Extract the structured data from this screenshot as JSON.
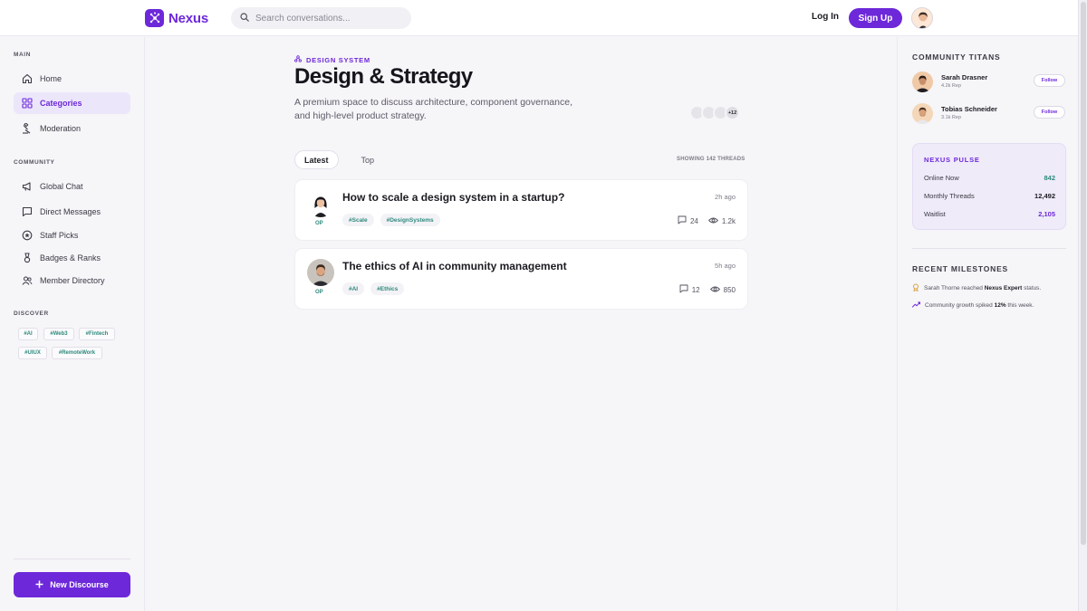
{
  "app": {
    "name": "Nexus",
    "accent": "#6d28d9",
    "teal": "#2e8a7d"
  },
  "header": {
    "search_placeholder": "Search conversations...",
    "login_label": "Log In",
    "signup_label": "Sign Up"
  },
  "sidebar": {
    "main_label": "MAIN",
    "main_items": [
      {
        "label": "Home",
        "icon": "home-icon",
        "active": false
      },
      {
        "label": "Categories",
        "icon": "grid-icon",
        "active": true
      },
      {
        "label": "Moderation",
        "icon": "gavel-icon",
        "active": false
      }
    ],
    "community_label": "COMMUNITY",
    "community_items": [
      {
        "label": "Global Chat",
        "icon": "megaphone-icon"
      },
      {
        "label": "Direct Messages",
        "icon": "message-icon"
      },
      {
        "label": "Staff Picks",
        "icon": "star-icon"
      },
      {
        "label": "Badges & Ranks",
        "icon": "medal-icon"
      },
      {
        "label": "Member Directory",
        "icon": "users-icon"
      }
    ],
    "discover_label": "DISCOVER",
    "discover_tags": [
      "#AI",
      "#Web3",
      "#Fintech",
      "#UIUX",
      "#RemoteWork"
    ],
    "new_button": "New Discourse"
  },
  "main": {
    "kicker": "DESIGN SYSTEM",
    "title": "Design & Strategy",
    "description": "A premium space to discuss architecture, component governance, and high-level product strategy.",
    "members_more": "+12",
    "tabs": [
      {
        "label": "Latest",
        "active": true
      },
      {
        "label": "Top",
        "active": false
      }
    ],
    "showing": "SHOWING 142 THREADS",
    "threads": [
      {
        "title": "How to scale a design system in a startup?",
        "op_label": "OP",
        "time": "2h ago",
        "tags": [
          "#Scale",
          "#DesignSystems"
        ],
        "comments": "24",
        "views": "1.2k"
      },
      {
        "title": "The ethics of AI in community management",
        "op_label": "OP",
        "time": "5h ago",
        "tags": [
          "#AI",
          "#Ethics"
        ],
        "comments": "12",
        "views": "850"
      }
    ]
  },
  "right": {
    "titans_heading": "COMMUNITY TITANS",
    "titans": [
      {
        "name": "Sarah Drasner",
        "rep": "4.2k Rep",
        "follow": "Follow"
      },
      {
        "name": "Tobias Schneider",
        "rep": "3.1k Rep",
        "follow": "Follow"
      }
    ],
    "pulse": {
      "title": "NEXUS PULSE",
      "rows": [
        {
          "label": "Online Now",
          "value": "842",
          "color": "#2e8a7d"
        },
        {
          "label": "Monthly Threads",
          "value": "12,492",
          "color": "#1c1b22"
        },
        {
          "label": "Waitlist",
          "value": "2,105",
          "color": "#6d28d9"
        }
      ]
    },
    "milestones_heading": "RECENT MILESTONES",
    "milestones": [
      {
        "pre": "Sarah Thorne reached ",
        "bold": "Nexus Expert",
        "post": " status."
      },
      {
        "pre": "Community growth spiked ",
        "bold": "12%",
        "post": " this week."
      }
    ]
  }
}
